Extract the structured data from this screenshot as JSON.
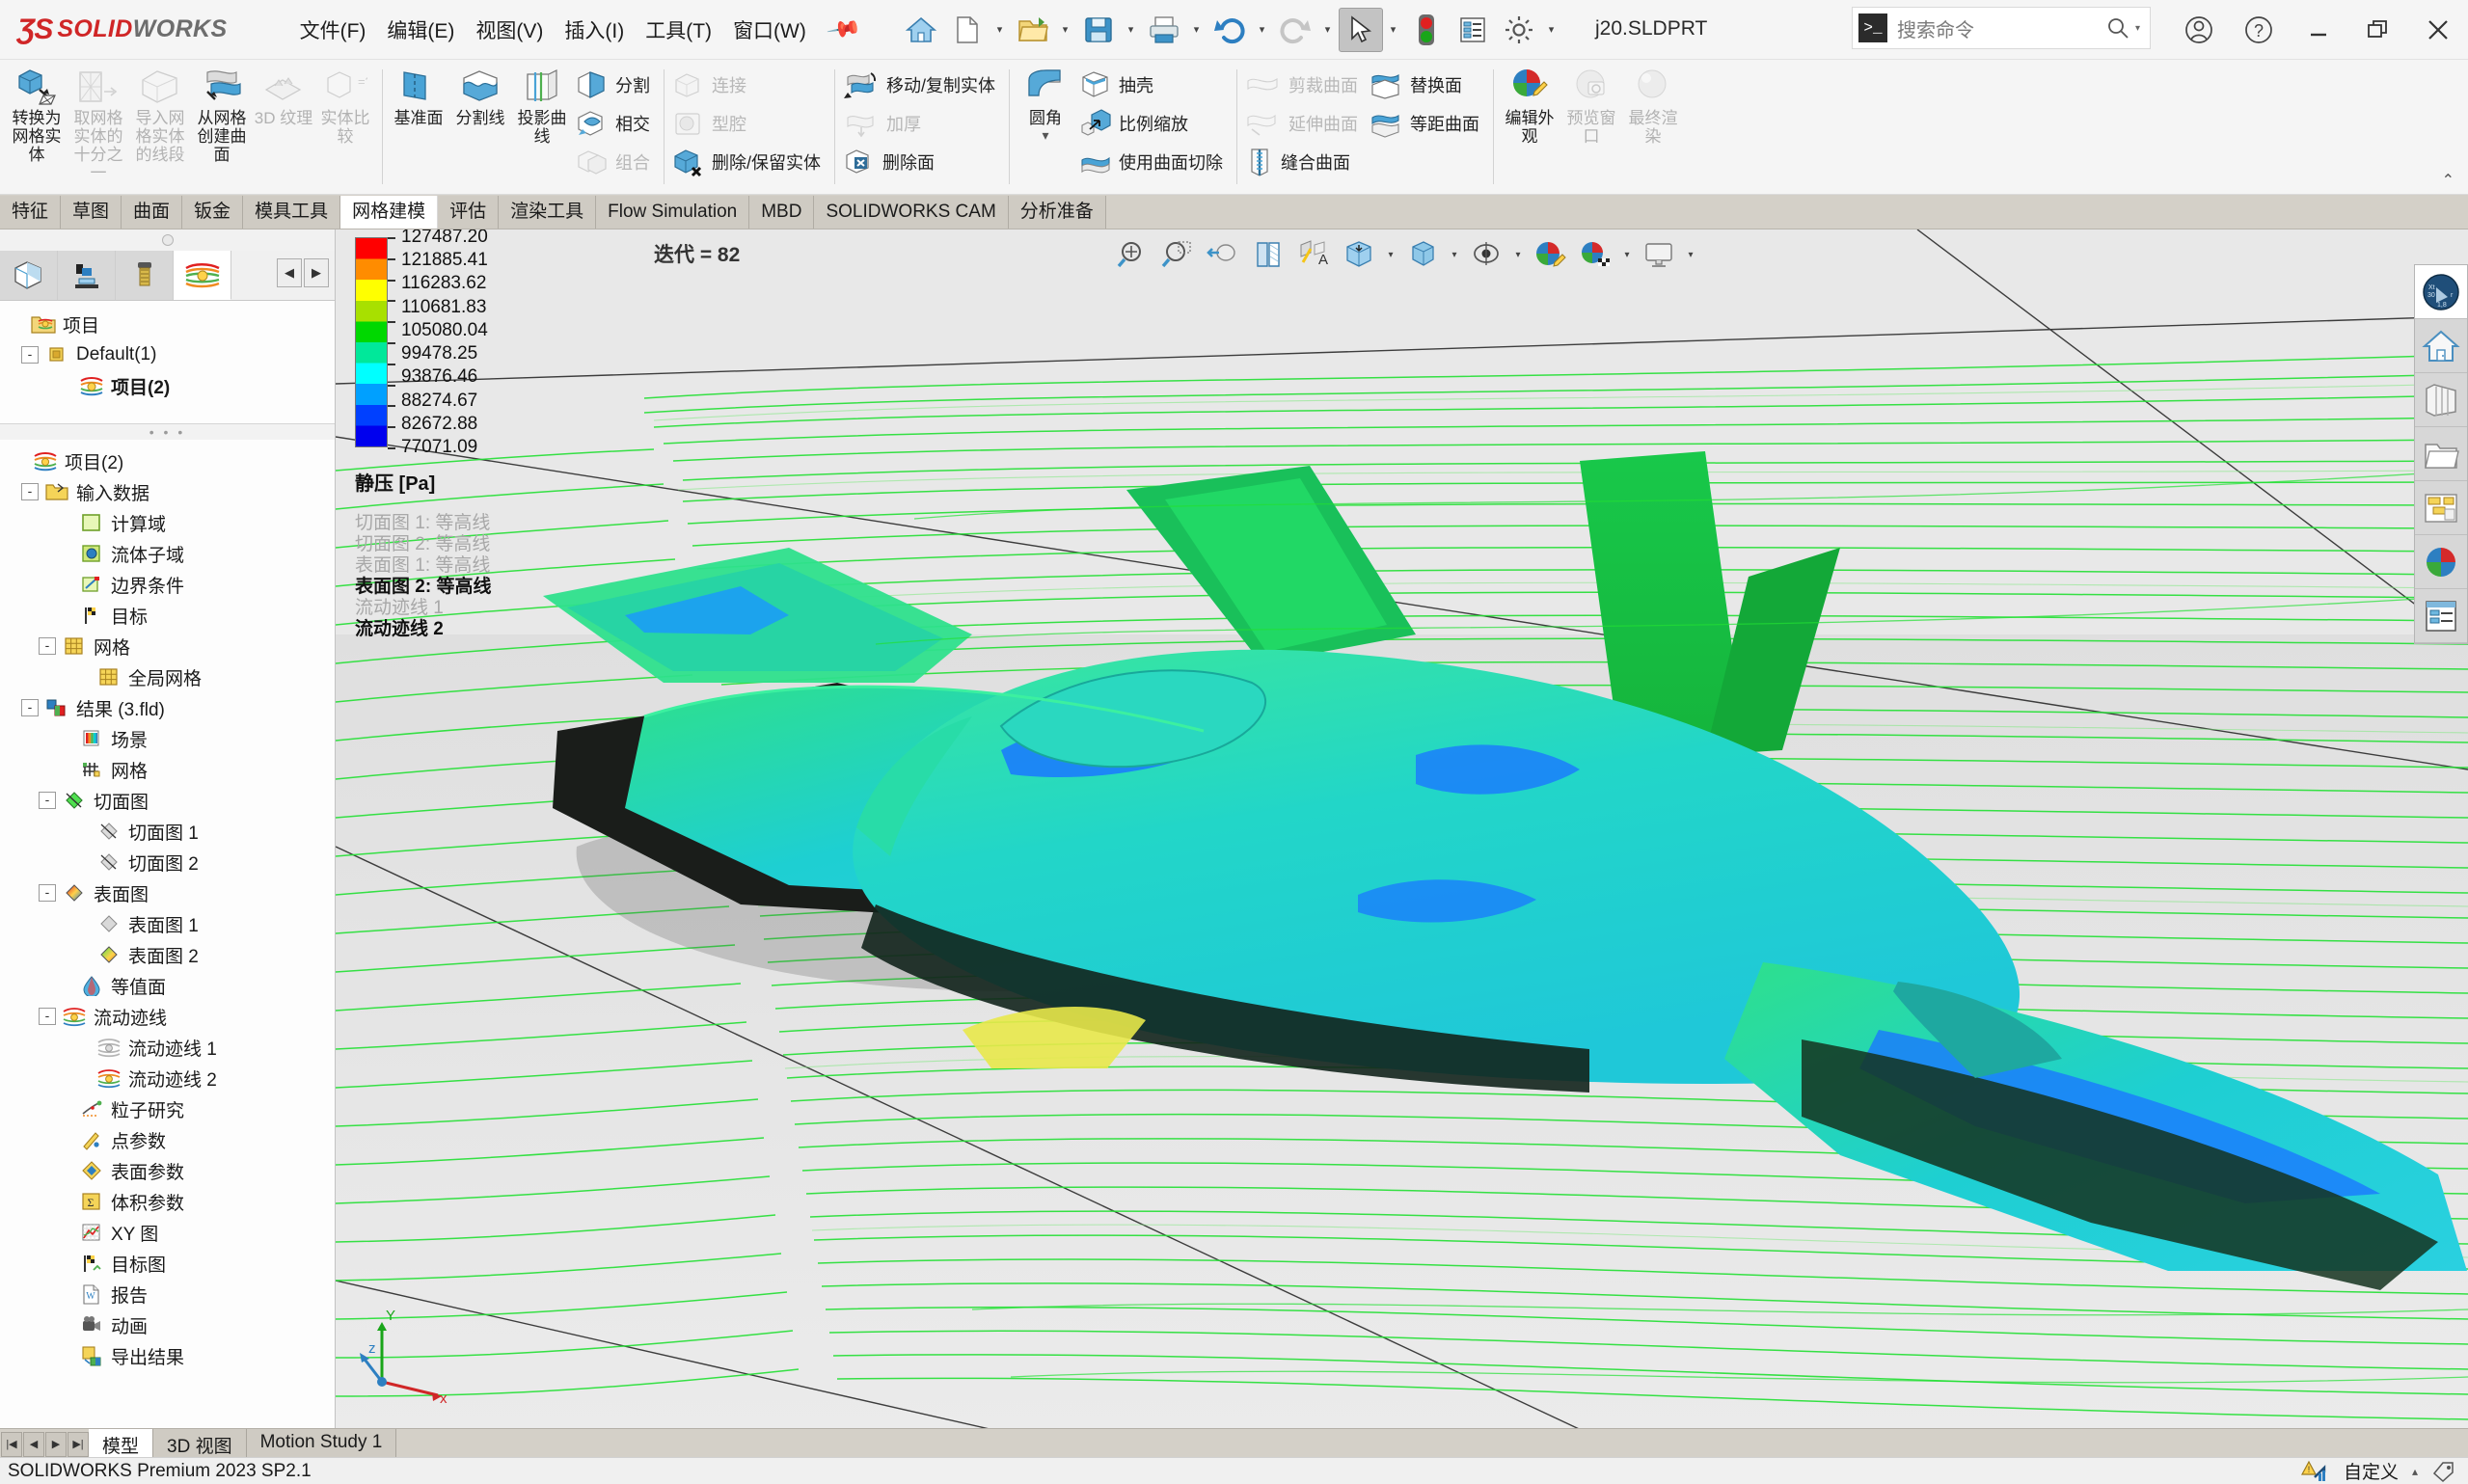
{
  "app": {
    "brand_ds": "ƷS",
    "brand_solid": "SOLID",
    "brand_works": "WORKS",
    "document_title": "j20.SLDPRT",
    "status_text": "SOLIDWORKS Premium 2023 SP2.1",
    "customize_label": "自定义",
    "accent_red": "#d02627",
    "accent_blue": "#2d7fc1"
  },
  "menubar": {
    "items": [
      {
        "label": "文件(F)",
        "name": "menu-file"
      },
      {
        "label": "编辑(E)",
        "name": "menu-edit"
      },
      {
        "label": "视图(V)",
        "name": "menu-view"
      },
      {
        "label": "插入(I)",
        "name": "menu-insert"
      },
      {
        "label": "工具(T)",
        "name": "menu-tools"
      },
      {
        "label": "窗口(W)",
        "name": "menu-window"
      }
    ]
  },
  "search": {
    "placeholder": "搜索命令"
  },
  "ribbon": {
    "groups": [
      {
        "name": "mesh-prep",
        "big_items": [
          {
            "label": "转换为网格实体",
            "dim": false,
            "icon": "convert-to-mesh-icon"
          },
          {
            "label": "取网格实体的十分之一",
            "dim": true,
            "icon": "decimate-mesh-icon"
          },
          {
            "label": "导入网格实体的线段",
            "dim": true,
            "icon": "import-mesh-segment-icon"
          },
          {
            "label": "从网格创建曲面",
            "dim": false,
            "icon": "surface-from-mesh-icon"
          },
          {
            "label": "3D 纹理",
            "dim": true,
            "icon": "texture-3d-icon"
          },
          {
            "label": "实体比较",
            "dim": true,
            "icon": "compare-bodies-icon"
          }
        ]
      },
      {
        "name": "reference-geometry",
        "big_items": [
          {
            "label": "基准面",
            "dim": false,
            "icon": "plane-icon"
          },
          {
            "label": "分割线",
            "dim": false,
            "icon": "split-line-icon"
          },
          {
            "label": "投影曲线",
            "dim": false,
            "icon": "projected-curve-icon"
          }
        ],
        "small_items": [
          {
            "label": "分割",
            "dim": false,
            "icon": "split-icon"
          },
          {
            "label": "相交",
            "dim": false,
            "icon": "intersect-icon"
          },
          {
            "label": "组合",
            "dim": true,
            "icon": "combine-icon"
          }
        ]
      },
      {
        "name": "body-tools",
        "small_items": [
          {
            "label": "连接",
            "dim": true,
            "icon": "join-icon"
          },
          {
            "label": "型腔",
            "dim": true,
            "icon": "cavity-icon"
          },
          {
            "label": "删除/保留实体",
            "dim": false,
            "icon": "delete-keep-body-icon"
          }
        ]
      },
      {
        "name": "move-modify",
        "small_items": [
          {
            "label": "移动/复制实体",
            "dim": false,
            "icon": "move-copy-body-icon"
          },
          {
            "label": "加厚",
            "dim": true,
            "icon": "thicken-icon"
          },
          {
            "label": "删除面",
            "dim": false,
            "icon": "delete-face-icon"
          }
        ]
      },
      {
        "name": "features",
        "big_items": [
          {
            "label": "圆角",
            "dim": false,
            "icon": "fillet-icon"
          }
        ],
        "small_items": [
          {
            "label": "抽壳",
            "dim": false,
            "icon": "shell-icon"
          },
          {
            "label": "比例缩放",
            "dim": false,
            "icon": "scale-icon"
          },
          {
            "label": "使用曲面切除",
            "dim": false,
            "icon": "cut-with-surface-icon"
          }
        ]
      },
      {
        "name": "surfaces",
        "small_items": [
          {
            "label": "剪裁曲面",
            "dim": true,
            "icon": "trim-surface-icon"
          },
          {
            "label": "延伸曲面",
            "dim": true,
            "icon": "extend-surface-icon"
          },
          {
            "label": "缝合曲面",
            "dim": false,
            "icon": "knit-surface-icon"
          }
        ]
      },
      {
        "name": "surface-ops",
        "small_items": [
          {
            "label": "替换面",
            "dim": false,
            "icon": "replace-face-icon"
          },
          {
            "label": "等距曲面",
            "dim": false,
            "icon": "offset-surface-icon"
          }
        ]
      },
      {
        "name": "render",
        "big_items": [
          {
            "label": "编辑外观",
            "dim": false,
            "icon": "edit-appearance-icon"
          },
          {
            "label": "预览窗口",
            "dim": true,
            "icon": "preview-window-icon"
          },
          {
            "label": "最终渲染",
            "dim": true,
            "icon": "final-render-icon"
          }
        ]
      }
    ]
  },
  "command_tabs": [
    {
      "label": "特征",
      "active": false
    },
    {
      "label": "草图",
      "active": false
    },
    {
      "label": "曲面",
      "active": false
    },
    {
      "label": "钣金",
      "active": false
    },
    {
      "label": "模具工具",
      "active": false
    },
    {
      "label": "网格建模",
      "active": true
    },
    {
      "label": "评估",
      "active": false
    },
    {
      "label": "渲染工具",
      "active": false
    },
    {
      "label": "Flow Simulation",
      "active": false
    },
    {
      "label": "MBD",
      "active": false
    },
    {
      "label": "SOLIDWORKS CAM",
      "active": false
    },
    {
      "label": "分析准备",
      "active": false
    }
  ],
  "left_panel": {
    "tabs": [
      {
        "name": "feature-manager-tab",
        "icon": "feature-tree-icon",
        "active": false
      },
      {
        "name": "property-manager-tab",
        "icon": "property-manager-icon",
        "active": false
      },
      {
        "name": "configuration-manager-tab",
        "icon": "configuration-icon",
        "active": false
      },
      {
        "name": "flow-simulation-tab",
        "icon": "flow-simulation-icon",
        "active": true
      }
    ],
    "config_tree": [
      {
        "label": "项目",
        "depth": 0,
        "expander": "",
        "icon": "project-folder-icon",
        "bold": false
      },
      {
        "label": "Default(1)",
        "depth": 1,
        "expander": "-",
        "icon": "configuration-yellow-icon",
        "bold": false
      },
      {
        "label": "项目(2)",
        "depth": 2,
        "expander": "",
        "icon": "flow-project-icon",
        "bold": true
      }
    ],
    "flow_tree": [
      {
        "label": "项目(2)",
        "depth": 0,
        "expander": "",
        "icon": "flow-project-icon"
      },
      {
        "label": "输入数据",
        "depth": 1,
        "expander": "-",
        "icon": "input-data-folder-icon"
      },
      {
        "label": "计算域",
        "depth": 2,
        "expander": "",
        "icon": "computational-domain-icon"
      },
      {
        "label": "流体子域",
        "depth": 2,
        "expander": "",
        "icon": "fluid-subdomain-icon"
      },
      {
        "label": "边界条件",
        "depth": 2,
        "expander": "",
        "icon": "boundary-conditions-icon"
      },
      {
        "label": "目标",
        "depth": 2,
        "expander": "",
        "icon": "goals-flag-icon"
      },
      {
        "label": "网格",
        "depth": 2,
        "expander": "-",
        "icon": "mesh-icon"
      },
      {
        "label": "全局网格",
        "depth": 3,
        "expander": "",
        "icon": "global-mesh-icon"
      },
      {
        "label": "结果 (3.fld)",
        "depth": 1,
        "expander": "-",
        "icon": "results-icon"
      },
      {
        "label": "场景",
        "depth": 2,
        "expander": "",
        "icon": "scene-icon"
      },
      {
        "label": "网格",
        "depth": 2,
        "expander": "",
        "icon": "result-mesh-icon"
      },
      {
        "label": "切面图",
        "depth": 2,
        "expander": "-",
        "icon": "cut-plot-icon"
      },
      {
        "label": "切面图 1",
        "depth": 3,
        "expander": "",
        "icon": "cut-plot-item-icon"
      },
      {
        "label": "切面图 2",
        "depth": 3,
        "expander": "",
        "icon": "cut-plot-item-icon"
      },
      {
        "label": "表面图",
        "depth": 2,
        "expander": "-",
        "icon": "surface-plot-icon"
      },
      {
        "label": "表面图 1",
        "depth": 3,
        "expander": "",
        "icon": "surface-plot-item-gray-icon"
      },
      {
        "label": "表面图 2",
        "depth": 3,
        "expander": "",
        "icon": "surface-plot-item-icon"
      },
      {
        "label": "等值面",
        "depth": 2,
        "expander": "",
        "icon": "isosurface-icon"
      },
      {
        "label": "流动迹线",
        "depth": 2,
        "expander": "-",
        "icon": "flow-trajectories-icon"
      },
      {
        "label": "流动迹线 1",
        "depth": 3,
        "expander": "",
        "icon": "flow-trajectory-gray-icon"
      },
      {
        "label": "流动迹线 2",
        "depth": 3,
        "expander": "",
        "icon": "flow-trajectory-icon"
      },
      {
        "label": "粒子研究",
        "depth": 2,
        "expander": "",
        "icon": "particle-study-icon"
      },
      {
        "label": "点参数",
        "depth": 2,
        "expander": "",
        "icon": "point-parameters-icon"
      },
      {
        "label": "表面参数",
        "depth": 2,
        "expander": "",
        "icon": "surface-parameters-icon"
      },
      {
        "label": "体积参数",
        "depth": 2,
        "expander": "",
        "icon": "volume-parameters-icon"
      },
      {
        "label": "XY 图",
        "depth": 2,
        "expander": "",
        "icon": "xy-plot-icon"
      },
      {
        "label": "目标图",
        "depth": 2,
        "expander": "",
        "icon": "goal-plot-icon"
      },
      {
        "label": "报告",
        "depth": 2,
        "expander": "",
        "icon": "report-icon"
      },
      {
        "label": "动画",
        "depth": 2,
        "expander": "",
        "icon": "animation-icon"
      },
      {
        "label": "导出结果",
        "depth": 2,
        "expander": "",
        "icon": "export-results-icon"
      }
    ]
  },
  "viewport": {
    "iteration_label": "迭代 = 82",
    "heads_up": [
      {
        "name": "zoom-to-fit-icon",
        "caret": false
      },
      {
        "name": "zoom-to-area-icon",
        "caret": false
      },
      {
        "name": "previous-view-icon",
        "caret": false
      },
      {
        "name": "section-view-icon",
        "caret": false
      },
      {
        "name": "view-orientation-icon",
        "caret": false
      },
      {
        "name": "view-orientation-cube-icon",
        "caret": true
      },
      {
        "name": "display-style-icon",
        "caret": true
      },
      {
        "name": "hide-show-items-icon",
        "caret": true
      },
      {
        "name": "edit-appearance-icon",
        "caret": false
      },
      {
        "name": "apply-scene-icon",
        "caret": true
      },
      {
        "name": "view-settings-icon",
        "caret": true
      }
    ],
    "right_toolbar": [
      {
        "name": "view-selector-icon",
        "active": true
      },
      {
        "name": "home-icon",
        "active": false
      },
      {
        "name": "library-icon",
        "active": false
      },
      {
        "name": "file-explorer-icon",
        "active": false
      },
      {
        "name": "view-palette-icon",
        "active": false
      },
      {
        "name": "appearances-icon",
        "active": false
      },
      {
        "name": "custom-properties-icon",
        "active": false
      }
    ]
  },
  "chart_data": {
    "type": "heatmap",
    "title": "静压 [Pa]",
    "subtitle": "迭代 = 82",
    "colorbar_label": "静压 [Pa]",
    "units": "Pa",
    "tick_labels": [
      "127487.20",
      "121885.41",
      "116283.62",
      "110681.83",
      "105080.04",
      "99478.25",
      "93876.46",
      "88274.67",
      "82672.88",
      "77071.09"
    ],
    "values": [
      127487.2,
      121885.41,
      116283.62,
      110681.83,
      105080.04,
      99478.25,
      93876.46,
      88274.67,
      82672.88,
      77071.09
    ],
    "range": [
      77071.09,
      127487.2
    ],
    "colors": [
      "#ff0000",
      "#ff8c00",
      "#ffff00",
      "#a8e000",
      "#00d800",
      "#00e89a",
      "#00ffff",
      "#00a0ff",
      "#0040ff",
      "#0000ee"
    ],
    "legend_position": "top-left",
    "plot_list": [
      {
        "label": "切面图 1: 等高线",
        "active": false
      },
      {
        "label": "切面图 2: 等高线",
        "active": false
      },
      {
        "label": "表面图 1: 等高线",
        "active": false
      },
      {
        "label": "表面图 2: 等高线",
        "active": true
      },
      {
        "label": "流动迹线 1",
        "active": false
      },
      {
        "label": "流动迹线 2",
        "active": true
      }
    ]
  },
  "doc_tabs": [
    {
      "label": "模型",
      "active": true
    },
    {
      "label": "3D 视图",
      "active": false
    },
    {
      "label": "Motion Study 1",
      "active": false
    }
  ],
  "axis_triad": {
    "x": "x",
    "y": "Y",
    "z": "z"
  }
}
